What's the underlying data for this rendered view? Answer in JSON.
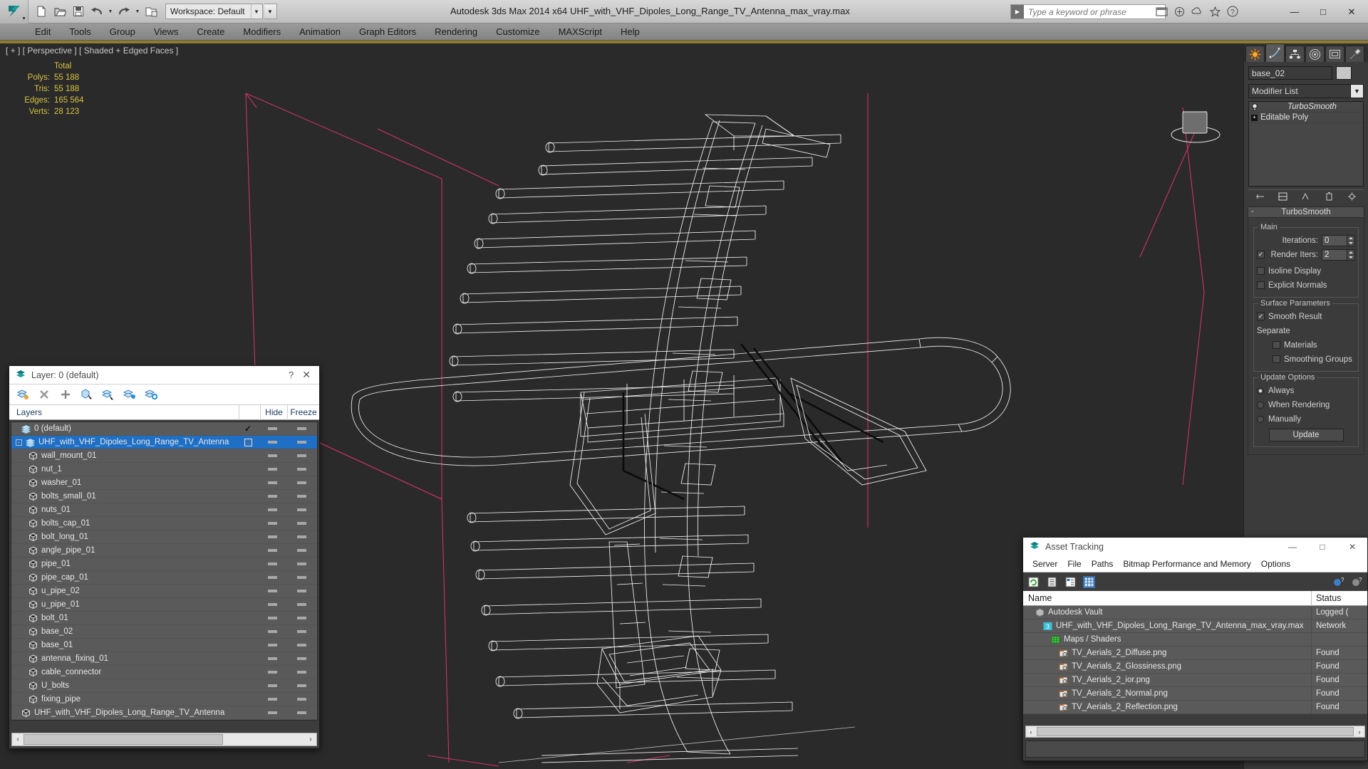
{
  "titlebar": {
    "app_title": "Autodesk 3ds Max  2014 x64",
    "file_title": "UHF_with_VHF_Dipoles_Long_Range_TV_Antenna_max_vray.max",
    "workspace_label": "Workspace: Default",
    "search_placeholder": "Type a keyword or phrase",
    "search_value": "",
    "quick_access": [
      {
        "name": "new-file-icon",
        "label": "New"
      },
      {
        "name": "open-file-icon",
        "label": "Open"
      },
      {
        "name": "save-file-icon",
        "label": "Save"
      },
      {
        "name": "undo-icon",
        "label": "Undo"
      },
      {
        "name": "undo-dropdown-icon",
        "label": "Undo list"
      },
      {
        "name": "redo-icon",
        "label": "Redo"
      },
      {
        "name": "redo-dropdown-icon",
        "label": "Redo list"
      },
      {
        "name": "set-project-folder-icon",
        "label": "Set Project Folder"
      }
    ],
    "window_buttons": [
      {
        "name": "minimize-button",
        "glyph": "—"
      },
      {
        "name": "maximize-button",
        "glyph": "□"
      },
      {
        "name": "close-button",
        "glyph": "✕"
      }
    ]
  },
  "menubar": {
    "items": [
      "Edit",
      "Tools",
      "Group",
      "Views",
      "Create",
      "Modifiers",
      "Animation",
      "Graph Editors",
      "Rendering",
      "Customize",
      "MAXScript",
      "Help"
    ]
  },
  "viewport": {
    "label": "[ + ] [ Perspective ] [ Shaded + Edged Faces ]",
    "stats_header": "Total",
    "stats": [
      {
        "label": "Polys:",
        "value": "55 188"
      },
      {
        "label": "Tris:",
        "value": "55 188"
      },
      {
        "label": "Edges:",
        "value": "165 564"
      },
      {
        "label": "Verts:",
        "value": "28 123"
      }
    ]
  },
  "command_panel": {
    "tabs": [
      {
        "name": "create-tab",
        "icon": "star-icon"
      },
      {
        "name": "modify-tab",
        "icon": "curve-icon",
        "active": true
      },
      {
        "name": "hierarchy-tab",
        "icon": "hierarchy-icon"
      },
      {
        "name": "motion-tab",
        "icon": "motion-icon"
      },
      {
        "name": "display-tab",
        "icon": "display-icon"
      },
      {
        "name": "utilities-tab",
        "icon": "hammer-icon"
      }
    ],
    "object_name": "base_02",
    "modifier_list_label": "Modifier List",
    "modifier_stack": [
      {
        "label": "TurboSmooth",
        "active": true
      },
      {
        "label": "Editable Poly",
        "active": false
      }
    ],
    "rollout": {
      "title": "TurboSmooth",
      "main_group": "Main",
      "iterations_label": "Iterations:",
      "iterations_value": "0",
      "render_iters_label": "Render Iters:",
      "render_iters_value": "2",
      "render_iters_checked": true,
      "isoline_display_label": "Isoline Display",
      "isoline_display_checked": false,
      "explicit_normals_label": "Explicit Normals",
      "explicit_normals_checked": false,
      "surface_group": "Surface Parameters",
      "smooth_result_label": "Smooth Result",
      "smooth_result_checked": true,
      "separate_label": "Separate",
      "materials_label": "Materials",
      "materials_checked": false,
      "smoothing_groups_label": "Smoothing Groups",
      "smoothing_groups_checked": false,
      "update_group": "Update Options",
      "update_options": [
        {
          "label": "Always",
          "selected": true
        },
        {
          "label": "When Rendering",
          "selected": false
        },
        {
          "label": "Manually",
          "selected": false
        }
      ],
      "update_button": "Update"
    }
  },
  "layer_dialog": {
    "title": "Layer: 0 (default)",
    "help_glyph": "?",
    "close_glyph": "✕",
    "toolbar": [
      {
        "name": "create-new-layer-icon"
      },
      {
        "name": "delete-layer-icon"
      },
      {
        "name": "add-selection-to-layer-icon"
      },
      {
        "name": "select-objects-in-layer-icon"
      },
      {
        "name": "set-current-layer-to-selection-icon"
      },
      {
        "name": "select-highlighted-objects-icon"
      },
      {
        "name": "layer-properties-icon"
      }
    ],
    "columns": [
      "Layers",
      "Hide",
      "Freeze"
    ],
    "rows": [
      {
        "label": "0 (default)",
        "type": "layer",
        "indent": 1,
        "expander": false,
        "mark": "check",
        "hide": "dash",
        "freeze": "dash",
        "selected": false
      },
      {
        "label": "UHF_with_VHF_Dipoles_Long_Range_TV_Antenna",
        "type": "layer",
        "indent": 0,
        "expander": "-",
        "mark": "box",
        "hide": "dash",
        "freeze": "dash",
        "selected": true
      },
      {
        "label": "wall_mount_01",
        "type": "object",
        "indent": 2,
        "expander": false,
        "mark": "",
        "hide": "dash",
        "freeze": "dash",
        "selected": false
      },
      {
        "label": "nut_1",
        "type": "object",
        "indent": 2,
        "expander": false,
        "mark": "",
        "hide": "dash",
        "freeze": "dash",
        "selected": false
      },
      {
        "label": "washer_01",
        "type": "object",
        "indent": 2,
        "expander": false,
        "mark": "",
        "hide": "dash",
        "freeze": "dash",
        "selected": false
      },
      {
        "label": "bolts_small_01",
        "type": "object",
        "indent": 2,
        "expander": false,
        "mark": "",
        "hide": "dash",
        "freeze": "dash",
        "selected": false
      },
      {
        "label": "nuts_01",
        "type": "object",
        "indent": 2,
        "expander": false,
        "mark": "",
        "hide": "dash",
        "freeze": "dash",
        "selected": false
      },
      {
        "label": "bolts_cap_01",
        "type": "object",
        "indent": 2,
        "expander": false,
        "mark": "",
        "hide": "dash",
        "freeze": "dash",
        "selected": false
      },
      {
        "label": "bolt_long_01",
        "type": "object",
        "indent": 2,
        "expander": false,
        "mark": "",
        "hide": "dash",
        "freeze": "dash",
        "selected": false
      },
      {
        "label": "angle_pipe_01",
        "type": "object",
        "indent": 2,
        "expander": false,
        "mark": "",
        "hide": "dash",
        "freeze": "dash",
        "selected": false
      },
      {
        "label": "pipe_01",
        "type": "object",
        "indent": 2,
        "expander": false,
        "mark": "",
        "hide": "dash",
        "freeze": "dash",
        "selected": false
      },
      {
        "label": "pipe_cap_01",
        "type": "object",
        "indent": 2,
        "expander": false,
        "mark": "",
        "hide": "dash",
        "freeze": "dash",
        "selected": false
      },
      {
        "label": "u_pipe_02",
        "type": "object",
        "indent": 2,
        "expander": false,
        "mark": "",
        "hide": "dash",
        "freeze": "dash",
        "selected": false
      },
      {
        "label": "u_pipe_01",
        "type": "object",
        "indent": 2,
        "expander": false,
        "mark": "",
        "hide": "dash",
        "freeze": "dash",
        "selected": false
      },
      {
        "label": "bolt_01",
        "type": "object",
        "indent": 2,
        "expander": false,
        "mark": "",
        "hide": "dash",
        "freeze": "dash",
        "selected": false
      },
      {
        "label": "base_02",
        "type": "object",
        "indent": 2,
        "expander": false,
        "mark": "",
        "hide": "dash",
        "freeze": "dash",
        "selected": false
      },
      {
        "label": "base_01",
        "type": "object",
        "indent": 2,
        "expander": false,
        "mark": "",
        "hide": "dash",
        "freeze": "dash",
        "selected": false
      },
      {
        "label": "antenna_fixing_01",
        "type": "object",
        "indent": 2,
        "expander": false,
        "mark": "",
        "hide": "dash",
        "freeze": "dash",
        "selected": false
      },
      {
        "label": "cable_connector",
        "type": "object",
        "indent": 2,
        "expander": false,
        "mark": "",
        "hide": "dash",
        "freeze": "dash",
        "selected": false
      },
      {
        "label": "U_bolts",
        "type": "object",
        "indent": 2,
        "expander": false,
        "mark": "",
        "hide": "dash",
        "freeze": "dash",
        "selected": false
      },
      {
        "label": "fixing_pipe",
        "type": "object",
        "indent": 2,
        "expander": false,
        "mark": "",
        "hide": "dash",
        "freeze": "dash",
        "selected": false
      },
      {
        "label": "UHF_with_VHF_Dipoles_Long_Range_TV_Antenna",
        "type": "object",
        "indent": 1,
        "expander": false,
        "mark": "",
        "hide": "dash",
        "freeze": "dash",
        "selected": false
      }
    ],
    "scroll_left_glyph": "‹",
    "scroll_right_glyph": "›"
  },
  "asset_dialog": {
    "title": "Asset Tracking",
    "window_buttons": [
      {
        "name": "minimize-button",
        "glyph": "—"
      },
      {
        "name": "maximize-button",
        "glyph": "□"
      },
      {
        "name": "close-button",
        "glyph": "✕"
      }
    ],
    "menu": [
      "Server",
      "File",
      "Paths",
      "Bitmap Performance and Memory",
      "Options"
    ],
    "toolbar": [
      {
        "name": "refresh-icon",
        "active": false
      },
      {
        "name": "list-view-icon",
        "active": false
      },
      {
        "name": "tree-view-icon",
        "active": false
      },
      {
        "name": "grid-view-icon",
        "active": true
      }
    ],
    "right_toolbar": [
      {
        "name": "help-globe-icon"
      },
      {
        "name": "help-icon"
      }
    ],
    "columns": [
      "Name",
      "Status"
    ],
    "rows": [
      {
        "name": "Autodesk Vault",
        "status": "Logged (",
        "indent": 1,
        "icon": "vault-icon"
      },
      {
        "name": "UHF_with_VHF_Dipoles_Long_Range_TV_Antenna_max_vray.max",
        "status": "Network",
        "indent": 2,
        "icon": "max-file-icon"
      },
      {
        "name": "Maps / Shaders",
        "status": "",
        "indent": 3,
        "icon": "maps-icon"
      },
      {
        "name": "TV_Aerials_2_Diffuse.png",
        "status": "Found",
        "indent": 4,
        "icon": "bitmap-icon"
      },
      {
        "name": "TV_Aerials_2_Glossiness.png",
        "status": "Found",
        "indent": 4,
        "icon": "bitmap-icon"
      },
      {
        "name": "TV_Aerials_2_ior.png",
        "status": "Found",
        "indent": 4,
        "icon": "bitmap-icon"
      },
      {
        "name": "TV_Aerials_2_Normal.png",
        "status": "Found",
        "indent": 4,
        "icon": "bitmap-icon"
      },
      {
        "name": "TV_Aerials_2_Reflection.png",
        "status": "Found",
        "indent": 4,
        "icon": "bitmap-icon"
      }
    ],
    "scroll_left_glyph": "‹",
    "scroll_right_glyph": "›"
  },
  "colors": {
    "accent_blue": "#1f6fc4",
    "viewport_bg": "#2a2a2a",
    "stats_yellow": "#d8c241",
    "gold_strip": "#8d7c2d",
    "wire_white": "#ffffff",
    "grid_magenta": "#d6336c"
  }
}
